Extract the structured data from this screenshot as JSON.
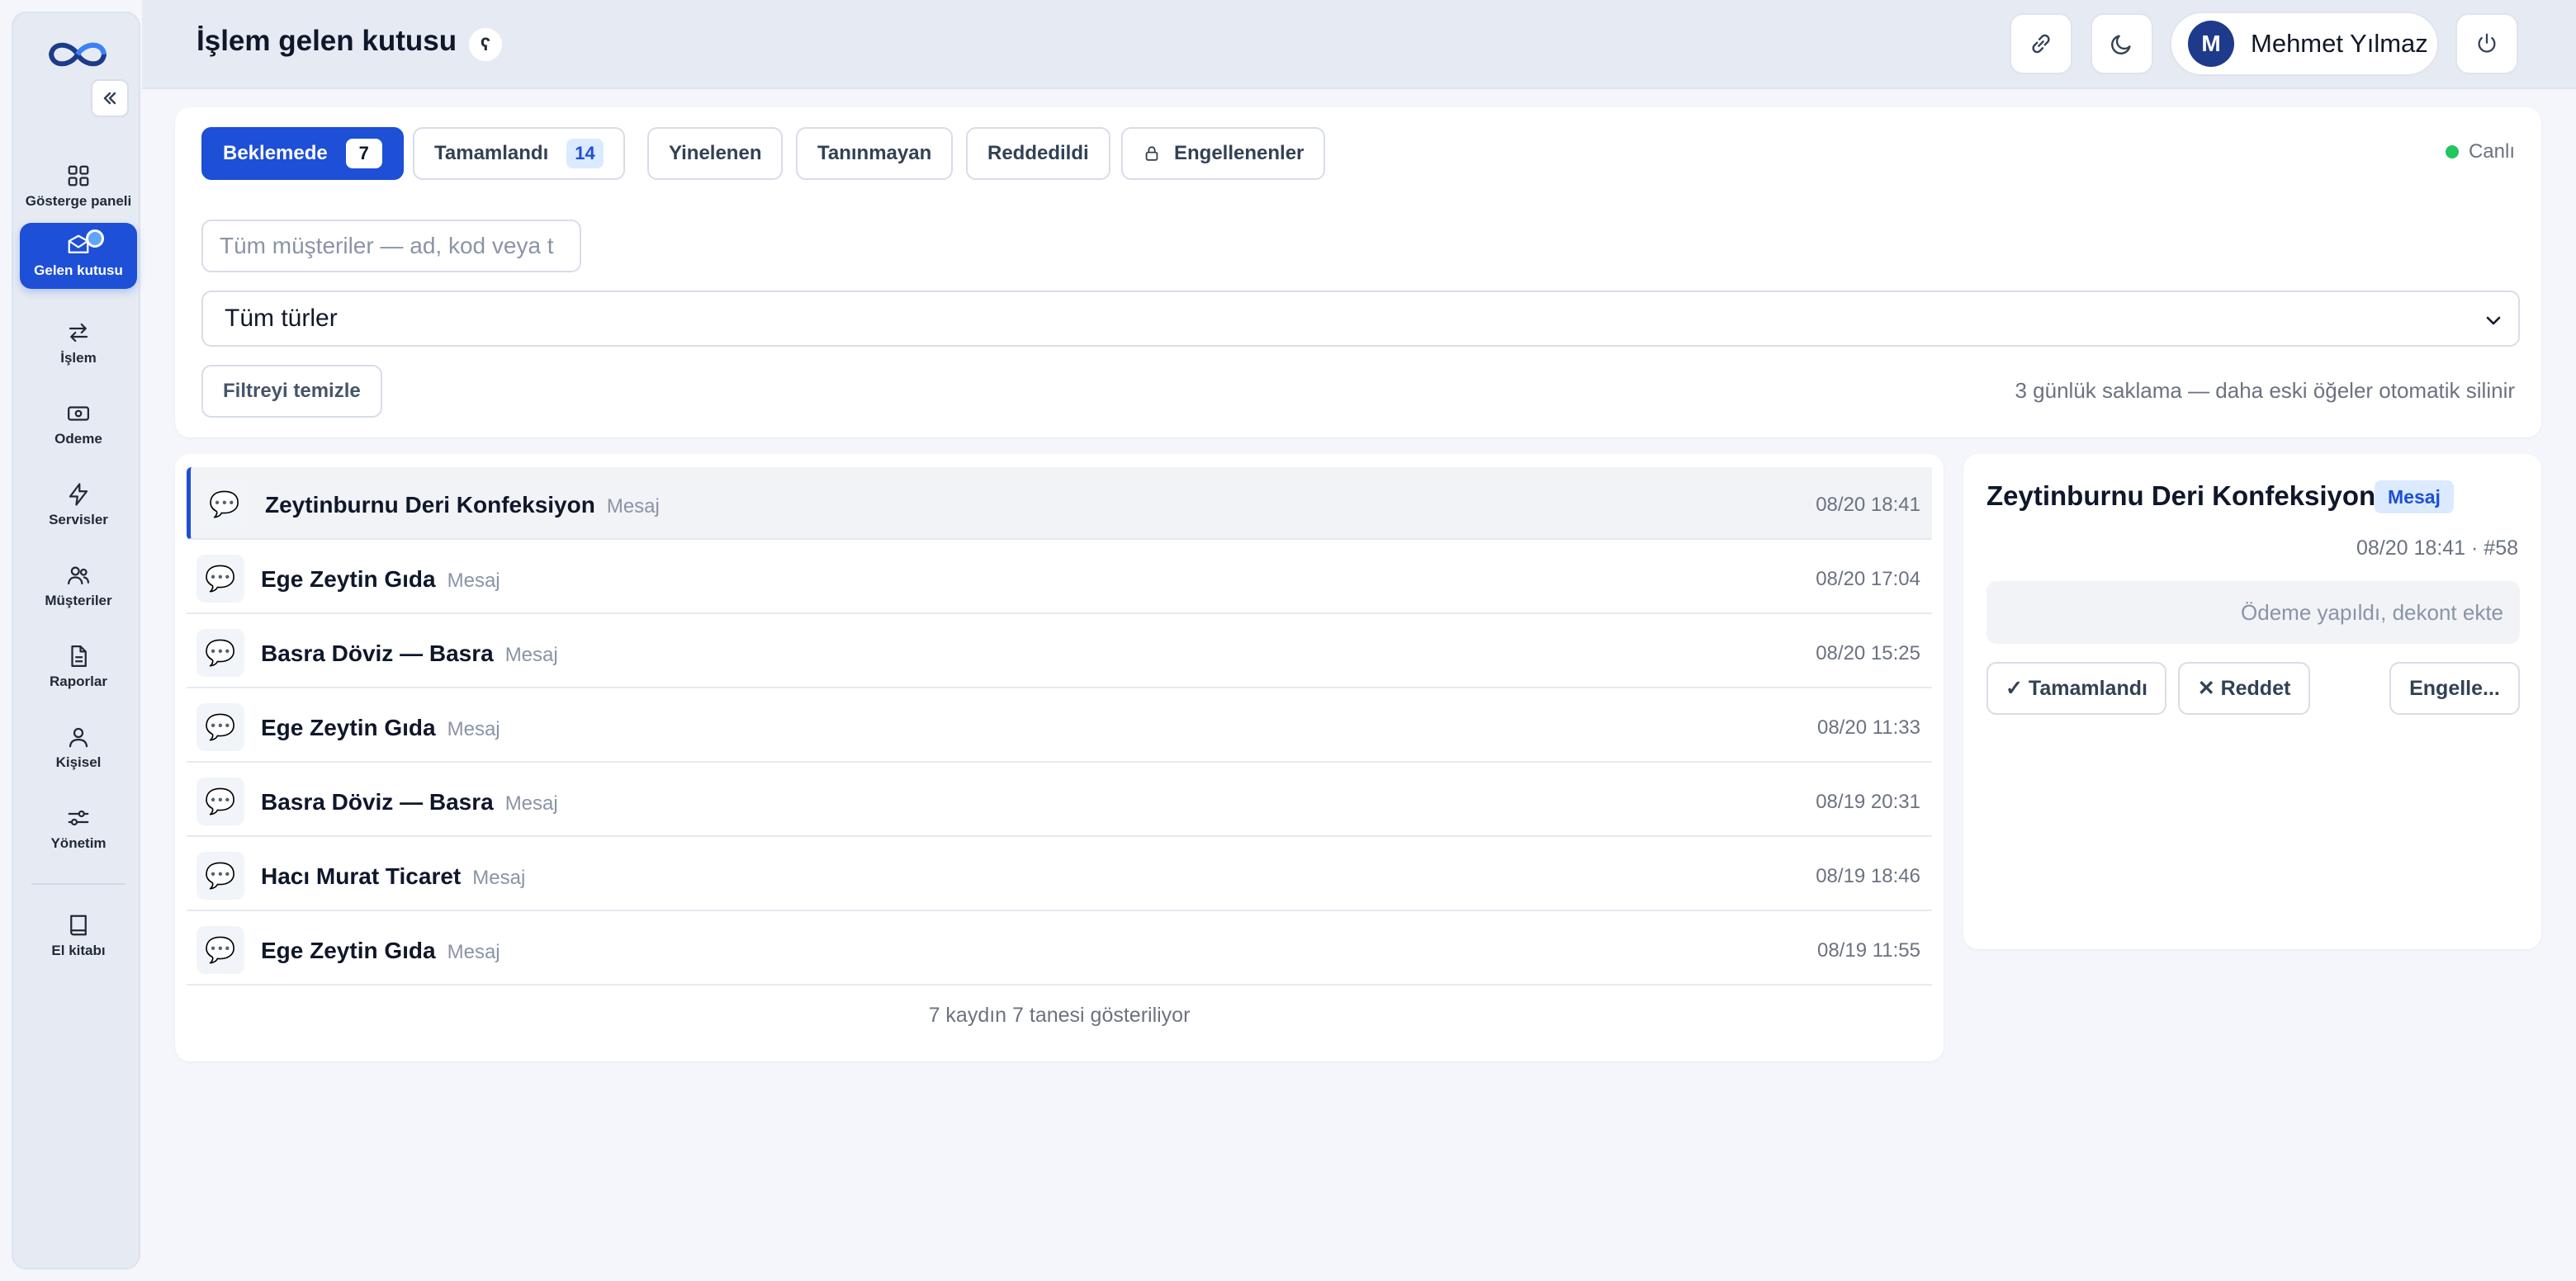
{
  "app": {
    "page_title": "İşlem gelen kutusu",
    "help_symbol": "ʕ"
  },
  "sidebar": {
    "items": [
      {
        "label": "Gösterge paneli",
        "icon": "dashboard-icon"
      },
      {
        "label": "Gelen kutusu",
        "icon": "inbox-icon",
        "active": true
      },
      {
        "label": "İşlem",
        "icon": "transfer-icon"
      },
      {
        "label": "Odeme",
        "icon": "payment-icon"
      },
      {
        "label": "Servisler",
        "icon": "bolt-icon"
      },
      {
        "label": "Müşteriler",
        "icon": "users-icon"
      },
      {
        "label": "Raporlar",
        "icon": "document-icon"
      },
      {
        "label": "Kişisel",
        "icon": "user-icon"
      },
      {
        "label": "Yönetim",
        "icon": "sliders-icon"
      },
      {
        "label": "El kitabı",
        "icon": "book-icon"
      }
    ]
  },
  "header": {
    "user_initial": "M",
    "user_name": "Mehmet Yılmaz"
  },
  "filters": {
    "tabs": [
      {
        "label": "Beklemede",
        "count": "7",
        "active": true
      },
      {
        "label": "Tamamlandı",
        "count": "14"
      },
      {
        "label": "Yinelenen"
      },
      {
        "label": "Tanınmayan"
      },
      {
        "label": "Reddedildi"
      },
      {
        "label": "Engellenenler",
        "icon": "lock-icon"
      }
    ],
    "live_label": "Canlı",
    "search_placeholder": "Tüm müşteriler — ad, kod veya t",
    "type_select_value": "Tüm türler",
    "clear_label": "Filtreyi temizle",
    "retention_note": "3 günlük saklama — daha eski öğeler otomatik silinir"
  },
  "list": {
    "rows": [
      {
        "name": "Zeytinburnu Deri Konfeksiyon",
        "type": "Mesaj",
        "time": "08/20 18:41",
        "selected": true
      },
      {
        "name": "Ege Zeytin Gıda",
        "type": "Mesaj",
        "time": "08/20 17:04"
      },
      {
        "name": "Basra Döviz — Basra",
        "type": "Mesaj",
        "time": "08/20 15:25"
      },
      {
        "name": "Ege Zeytin Gıda",
        "type": "Mesaj",
        "time": "08/20 11:33"
      },
      {
        "name": "Basra Döviz — Basra",
        "type": "Mesaj",
        "time": "08/19 20:31"
      },
      {
        "name": "Hacı Murat Ticaret",
        "type": "Mesaj",
        "time": "08/19 18:46"
      },
      {
        "name": "Ege Zeytin Gıda",
        "type": "Mesaj",
        "time": "08/19 11:55"
      }
    ],
    "row_icon": "💬",
    "footer": "7 kaydın 7 tanesi gösteriliyor"
  },
  "detail": {
    "title": "Zeytinburnu Deri Konfeksiyon",
    "badge": "Mesaj",
    "meta": "08/20 18:41 · #58",
    "message": "Ödeme yapıldı, dekont ekte",
    "complete_label": "✓ Tamamlandı",
    "reject_label": "✕ Reddet",
    "block_label": "Engelle..."
  },
  "colors": {
    "accent": "#1d4fd7",
    "live": "#22c55e",
    "badge_bg": "#dbeafe"
  }
}
